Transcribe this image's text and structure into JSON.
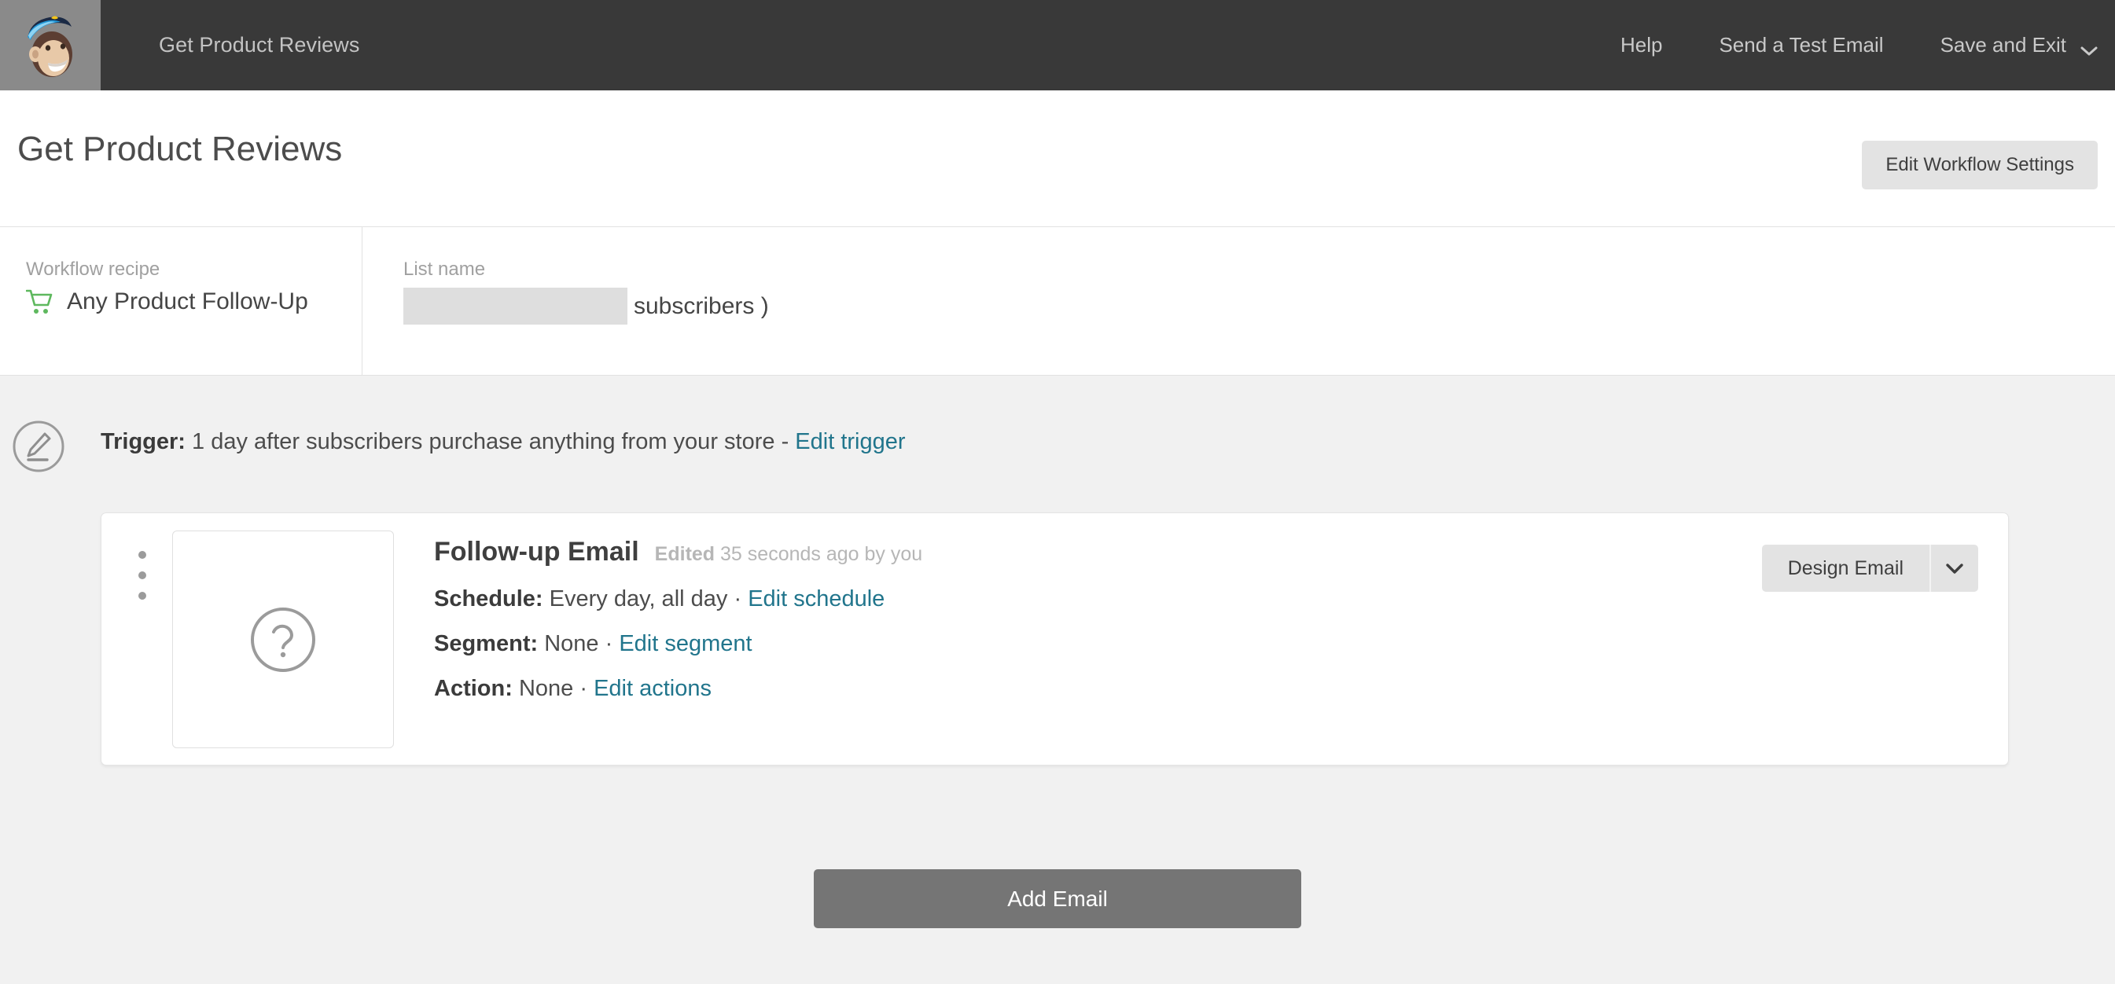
{
  "topbar": {
    "logo_icon": "mailchimp-freddie-logo",
    "workflow_name": "Get Product Reviews",
    "links": [
      {
        "label": "Help",
        "name": "help-link"
      },
      {
        "label": "Send a Test Email",
        "name": "send-test-email-link"
      },
      {
        "label": "Save and Exit",
        "name": "save-and-exit-link"
      }
    ],
    "save_exit_caret_icon": "chevron-down-icon"
  },
  "header": {
    "page_title": "Get Product Reviews",
    "settings_button": "Edit Workflow Settings"
  },
  "summary": {
    "recipe_label": "Workflow recipe",
    "recipe_icon": "shopping-cart-icon",
    "recipe_value": "Any Product Follow-Up",
    "list_label": "List name",
    "list_value": "",
    "list_suffix": "subscribers )"
  },
  "trigger": {
    "edit_icon": "pencil-edit-icon",
    "prefix": "Trigger:",
    "description": "1 day after subscribers purchase anything from your store",
    "separator": "-",
    "edit_link": "Edit trigger"
  },
  "email": {
    "drag_handle_icon": "drag-handle-dots-icon",
    "thumbnail_icon": "question-mark-circle-icon",
    "title": "Follow-up Email",
    "edited_prefix": "Edited",
    "edited_time": "35 seconds ago by you",
    "rows": [
      {
        "label": "Schedule:",
        "value": "Every day, all day",
        "sep": "·",
        "link": "Edit schedule",
        "name": "schedule"
      },
      {
        "label": "Segment:",
        "value": "None",
        "sep": "·",
        "link": "Edit segment",
        "name": "segment"
      },
      {
        "label": "Action:",
        "value": "None",
        "sep": "·",
        "link": "Edit actions",
        "name": "action"
      }
    ],
    "design_button": "Design Email",
    "design_caret_icon": "chevron-down-icon"
  },
  "footer": {
    "add_email_button": "Add Email"
  },
  "colors": {
    "topbar_bg": "#393939",
    "logo_bg": "#8a8a8a",
    "body_bg": "#f1f1f1",
    "link_teal": "#21758c",
    "cart_green": "#5eb85e",
    "button_gray": "#e3e3e3",
    "primary_button": "#757575"
  }
}
